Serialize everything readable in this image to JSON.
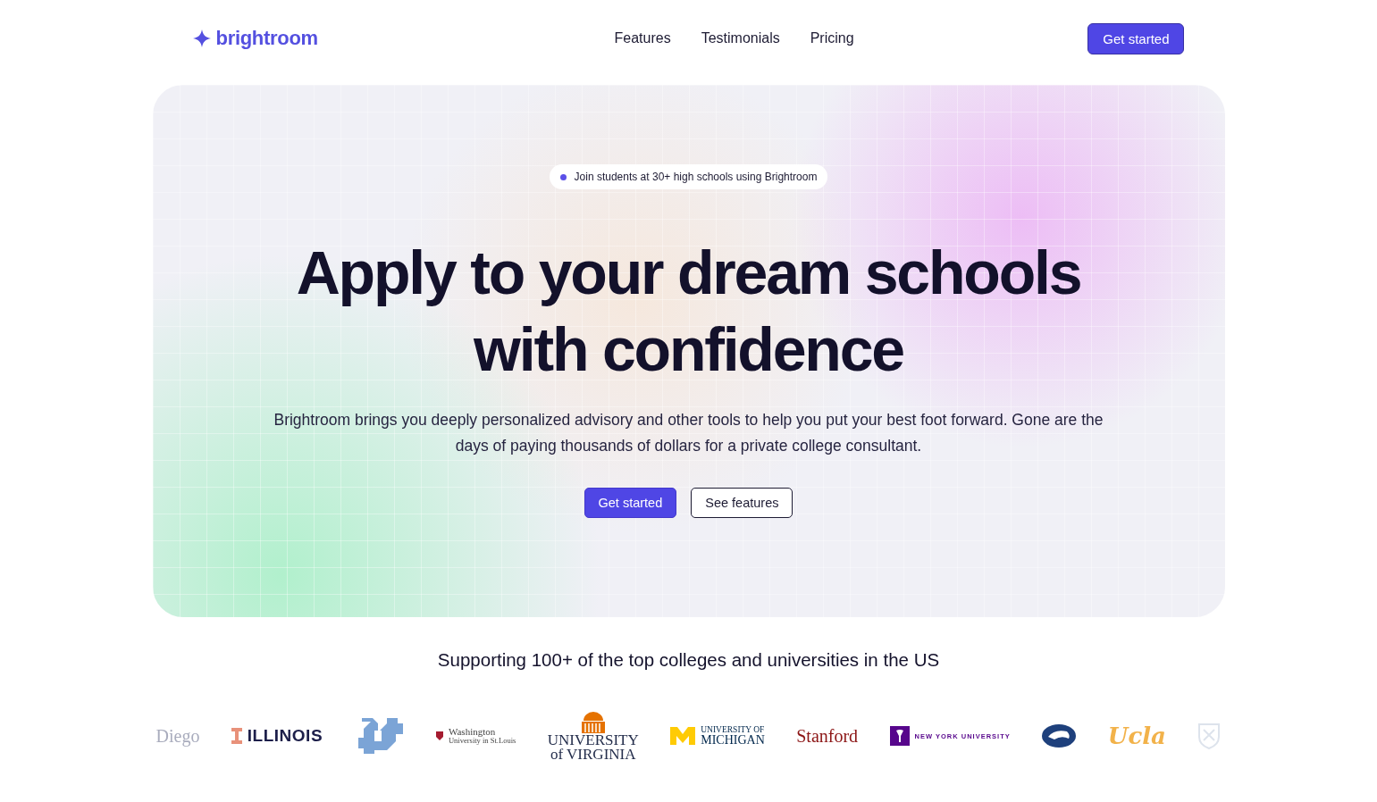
{
  "nav": {
    "logo": "brightroom",
    "links": [
      "Features",
      "Testimonials",
      "Pricing"
    ],
    "cta": "Get started"
  },
  "hero": {
    "badge": "Join students at 30+ high schools using Brightroom",
    "title_lines": [
      "Apply to your dream schools",
      "with confidence"
    ],
    "subtitle": "Brightroom brings you deeply personalized advisory and other tools to help you put your best foot forward. Gone are the days of paying thousands of dollars for a private college consultant.",
    "buttons": [
      {
        "label": "Get started",
        "kind": "primary"
      },
      {
        "label": "See features",
        "kind": "outline"
      }
    ]
  },
  "logos": {
    "heading": "Supporting 100+ of the top colleges and universities in the US",
    "items": [
      {
        "kind": "faded",
        "text": "Diego"
      },
      {
        "kind": "illinois",
        "text": "ILLINOIS"
      },
      {
        "kind": "unc"
      },
      {
        "kind": "washu",
        "text": "Washington",
        "text_2": "University in St.Louis"
      },
      {
        "kind": "uva",
        "text": "UNIVERSITY",
        "text_2": "of VIRGINIA"
      },
      {
        "kind": "michigan",
        "text": "UNIVERSITY OF",
        "text_2": "MICHIGAN"
      },
      {
        "kind": "stanford",
        "text": "Stanford"
      },
      {
        "kind": "nyu",
        "text": "NEW YORK UNIVERSITY"
      },
      {
        "kind": "pennstate"
      },
      {
        "kind": "ucla",
        "text": "Ucla"
      },
      {
        "kind": "shield"
      }
    ]
  }
}
